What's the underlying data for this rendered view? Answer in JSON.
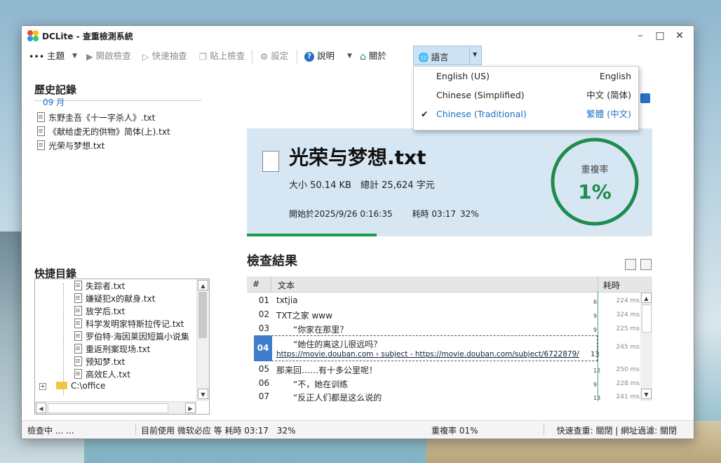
{
  "window": {
    "title": "DCLite - 查重檢測系統"
  },
  "toolbar": {
    "theme_label": "主題",
    "open_label": "開啟檢查",
    "quick_label": "快速抽查",
    "paste_label": "貼上檢查",
    "settings_label": "設定",
    "help_label": "說明",
    "about_label": "關於",
    "lang_label": "語言"
  },
  "language_menu": [
    {
      "name": "English (US)",
      "native": "English",
      "selected": false
    },
    {
      "name": "Chinese (Simplified)",
      "native": "中文 (简体)",
      "selected": true
    },
    {
      "name": "Chinese (Traditional)",
      "native": "繁體 (中文)",
      "selected": true
    }
  ],
  "history": {
    "title": "歷史記錄",
    "month": "09 月",
    "items": [
      "东野圭吾《十一字杀人》.txt",
      "《献给虚无的供物》简体(上).txt",
      "光荣与梦想.txt"
    ]
  },
  "quick_dir": {
    "title": "快捷目錄",
    "items": [
      "失踪者.txt",
      "嫌疑犯x的献身.txt",
      "放学后.txt",
      "科学发明家特斯拉传记.txt",
      "罗伯特·海因莱因短篇小说集",
      "重返刑案现场.txt",
      "预知梦.txt",
      "高效E人.txt"
    ],
    "folder": "C:\\office"
  },
  "current_file": {
    "name": "光荣与梦想.txt",
    "size_label": "大小 50.14 KB",
    "total_label": "總計 25,624 字元",
    "start_label": "開始於2025/9/26 0:16:35",
    "elapsed_label": "耗時 03:17",
    "progress_label": "32%",
    "progress": 0.32,
    "dup_label": "重複率",
    "dup_value": "1%"
  },
  "results": {
    "title": "檢查結果",
    "columns": [
      "#",
      "文本",
      "耗時"
    ],
    "rows": [
      {
        "num": "01",
        "text": "txtjia",
        "side": "6",
        "ms": "224 ms"
      },
      {
        "num": "02",
        "text": "TXT之家 www",
        "side": "9",
        "ms": "324 ms"
      },
      {
        "num": "03",
        "text": "　　“你家在那里？",
        "side": "9",
        "ms": "225 ms"
      },
      {
        "num": "04",
        "text": "“她住的离这儿很远吗？",
        "url": "https://movie.douban.com › subject - https://movie.douban.com/subject/6722879/",
        "side": "13",
        "ms": "245 ms"
      },
      {
        "num": "05",
        "text": "那来回……有十多公里呢！",
        "side": "12",
        "ms": "250 ms"
      },
      {
        "num": "06",
        "text": "　　“不，她在训练",
        "side": "9",
        "ms": "228 ms"
      },
      {
        "num": "07",
        "text": "　　“反正人们都是这么说的",
        "side": "13",
        "ms": "241 ms"
      }
    ]
  },
  "status": {
    "state": "檢查中 ... ...",
    "engine": "目前使用 微软必应 等 耗時 03:17　32%",
    "dup": "重複率 01%",
    "flags": "快速查重: 關閉 | 網址過濾: 關閉"
  },
  "colors": {
    "accent": "#1c72c4",
    "success": "#1f8b4c",
    "card_bg": "#d6e6f3"
  }
}
